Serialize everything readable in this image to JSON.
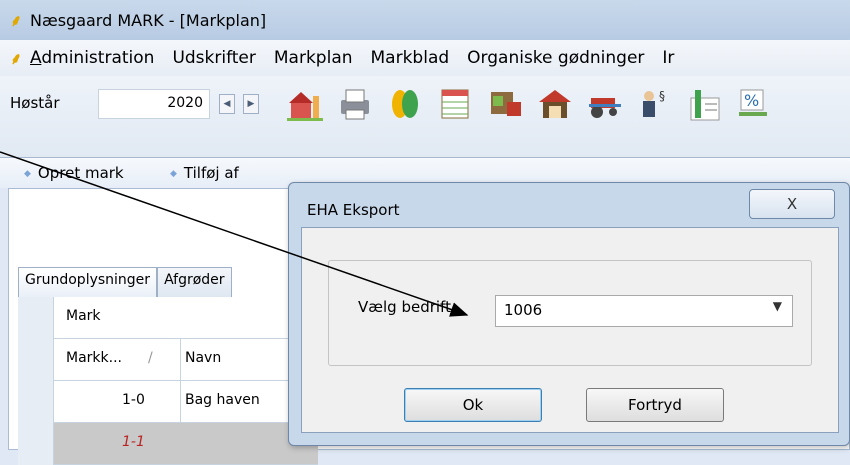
{
  "window": {
    "title": "Næsgaard MARK - [Markplan]",
    "app_icon": "leaf-icon"
  },
  "menubar": {
    "items": [
      {
        "label": "Administration"
      },
      {
        "label": "Udskrifter"
      },
      {
        "label": "Markplan"
      },
      {
        "label": "Markblad"
      },
      {
        "label": "Organiske gødninger"
      },
      {
        "label": "Ir"
      }
    ]
  },
  "toolbar": {
    "year_label": "Høstår",
    "year_value": "2020",
    "icons": [
      "farm-icon",
      "printer-icon",
      "grain-icon",
      "table-icon",
      "fertilizer-icon",
      "barn-icon",
      "tractor-icon",
      "document-icon",
      "chart-icon",
      "percent-icon"
    ]
  },
  "actions": {
    "create_field": "Opret mark",
    "add_field": "Tilføj af"
  },
  "tabs": {
    "basic": "Grundoplysninger",
    "crops": "Afgrøder"
  },
  "grid": {
    "group_header": "Mark",
    "col_field_number": "Markk...",
    "col_name": "Navn",
    "rows": [
      {
        "number": "1-0",
        "name": "Bag haven"
      },
      {
        "number": "1-1",
        "name": ""
      }
    ]
  },
  "dialog": {
    "title": "EHA Eksport",
    "close_label": "X",
    "company_label": "Vælg bedrift",
    "company_value": "1006",
    "ok_label": "Ok",
    "cancel_label": "Fortryd"
  }
}
